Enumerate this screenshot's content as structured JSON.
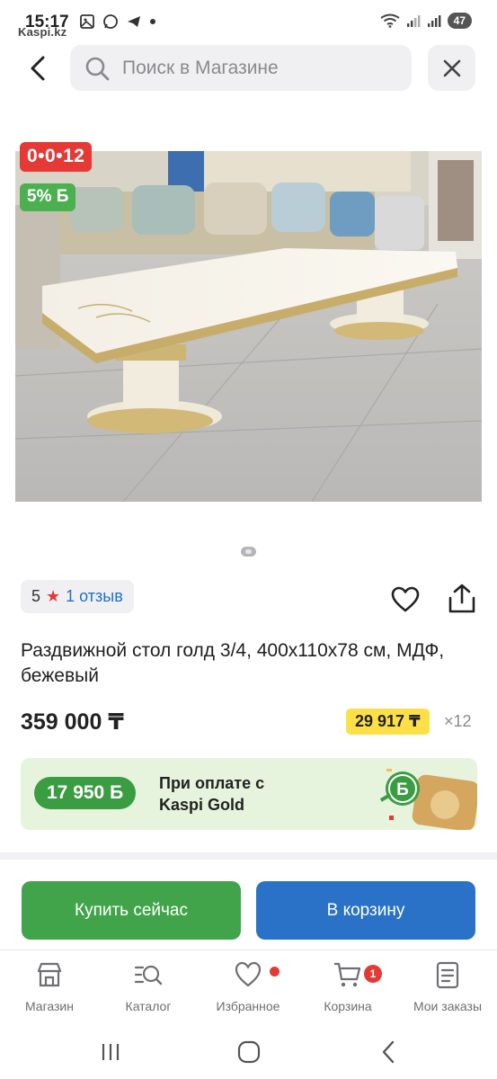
{
  "status_bar": {
    "time": "15:17",
    "watermark": "Kaspi.kz",
    "battery": "47"
  },
  "search": {
    "placeholder": "Поиск в Магазине"
  },
  "product": {
    "badge_installment": "0•0•12",
    "badge_bonus": "5% Б",
    "rating": "5",
    "reviews": "1 отзыв",
    "title": "Раздвижной стол голд 3/4, 400x110x78 см, МДФ, бежевый",
    "price": "359 000 ₸",
    "installment_price": "29 917 ₸",
    "installment_months": "×12"
  },
  "gold_offer": {
    "bonus": "17 950 Б",
    "text": "При оплате с Kaspi Gold"
  },
  "actions": {
    "buy_now": "Купить сейчас",
    "add_to_cart": "В корзину"
  },
  "bottom_nav": {
    "items": [
      {
        "label": "Магазин",
        "icon": "store-icon"
      },
      {
        "label": "Каталог",
        "icon": "catalog-icon"
      },
      {
        "label": "Избранное",
        "icon": "heart-icon"
      },
      {
        "label": "Корзина",
        "icon": "cart-icon"
      },
      {
        "label": "Мои заказы",
        "icon": "orders-icon"
      }
    ],
    "cart_count": "1"
  },
  "colors": {
    "accent_red": "#e53935",
    "buy_green": "#41a44b",
    "cart_blue": "#2a72c8",
    "installment_yellow": "#fde047"
  }
}
